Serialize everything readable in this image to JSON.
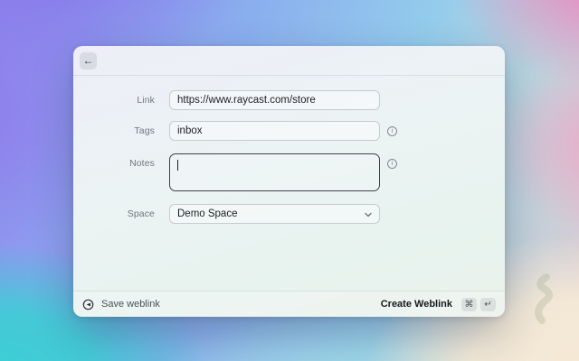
{
  "window": {
    "header": {
      "back_icon": "←"
    },
    "form": {
      "fields": [
        {
          "label": "Link",
          "value": "https://www.raycast.com/store",
          "type": "text"
        },
        {
          "label": "Tags",
          "value": "inbox",
          "type": "text",
          "info": true
        },
        {
          "label": "Notes",
          "value": "",
          "type": "textarea",
          "info": true,
          "focused": true
        },
        {
          "label": "Space",
          "value": "Demo Space",
          "type": "select"
        }
      ],
      "info_icon_glyph": "i"
    },
    "footer": {
      "save_label": "Save weblink",
      "create_label": "Create Weblink",
      "shortcut": {
        "cmd": "⌘",
        "enter": "↵"
      }
    }
  },
  "colors": {
    "bg_purple": "#8b7ce9",
    "bg_blue": "#86aaee",
    "bg_cyan_top": "#98d4ee",
    "bg_pink": "#ec8cc0",
    "bg_teal": "#3ad0d4",
    "bg_cream": "#f4e7d3",
    "window_tint_top": "#edeef7",
    "window_tint_bottom": "#e7f3ef",
    "focused_border": "#3e4248"
  }
}
